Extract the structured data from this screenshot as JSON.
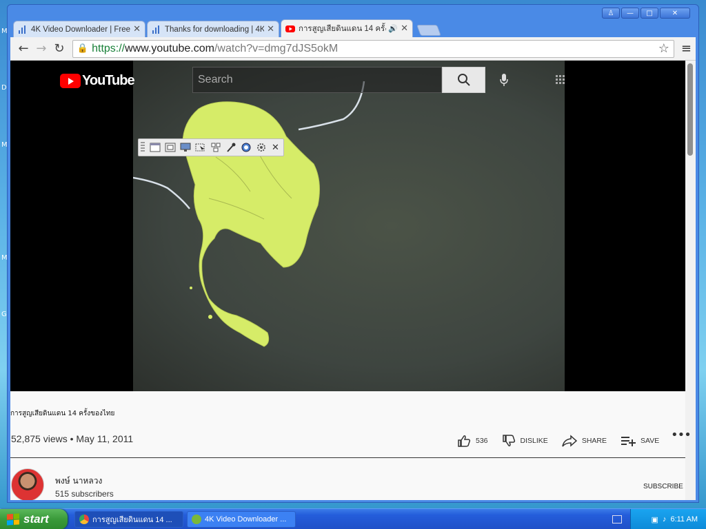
{
  "desktop": {
    "letters": [
      "M",
      "D",
      "M",
      "M",
      "G"
    ]
  },
  "window": {
    "controls": {
      "user": "♙",
      "minimize": "—",
      "maximize": "□",
      "close": "✕"
    }
  },
  "tabs": [
    {
      "title": "4K Video Downloader | Free",
      "icon": "bar-chart-icon",
      "close": "✕"
    },
    {
      "title": "Thanks for downloading | 4K",
      "icon": "bar-chart-icon",
      "close": "✕"
    },
    {
      "title": "การสูญเสียดินแดน 14 ครั้ง",
      "icon": "youtube-icon",
      "close": "✕",
      "audio": "🔊"
    }
  ],
  "toolbar": {
    "back": "←",
    "forward": "→",
    "reload": "↻",
    "url_scheme": "https://",
    "url_host": "www.youtube.com",
    "url_path": "/watch?v=dmg7dJS5okM",
    "star": "☆",
    "menu": "≡"
  },
  "youtube": {
    "logo_text": "YouTube",
    "search_placeholder": "Search"
  },
  "video": {
    "title": "การสูญเสียดินแดน 14 ครั้งของไทย",
    "views": "52,875 views",
    "separator": "•",
    "date": "May 11, 2011",
    "likes": "536",
    "dislike_label": "DISLIKE",
    "share_label": "SHARE",
    "save_label": "SAVE",
    "more": "•••"
  },
  "channel": {
    "name": "พงษ์ นาหลวง",
    "subscribers": "515 subscribers",
    "subscribe_label": "SUBSCRIBE"
  },
  "taskbar": {
    "start_label": "start",
    "items": [
      {
        "label": "การสูญเสียดินแดน 14 ...",
        "icon": "chrome-icon",
        "color": "#e8453c"
      },
      {
        "label": "4K Video Downloader ...",
        "icon": "4k-downloader-icon",
        "color": "#7ab83a"
      }
    ],
    "clock": "6:11 AM"
  },
  "colors": {
    "youtube_red": "#ff0000",
    "xp_blue": "#245ddb",
    "start_green": "#3a9a3a",
    "map_land": "#d8ee6a"
  }
}
